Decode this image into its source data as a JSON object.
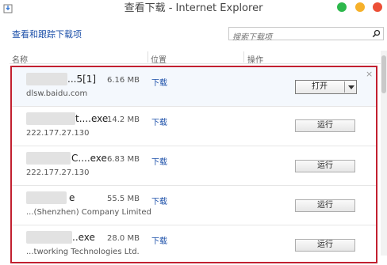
{
  "window": {
    "title": "查看下载 - Internet Explorer",
    "controls": {
      "minimize_color": "#2db84c",
      "maximize_color": "#f6b12a",
      "close_color": "#ec4f36"
    }
  },
  "header": {
    "link_label": "查看和跟踪下载项",
    "search_placeholder": "搜索下载项"
  },
  "columns": {
    "name": "名称",
    "location": "位置",
    "actions": "操作"
  },
  "downloads": [
    {
      "name": "...5[1]",
      "source": "dlsw.baidu.com",
      "size": "6.16 MB",
      "location": "下载",
      "action": "打开",
      "action_has_menu": true
    },
    {
      "name": "t....exe",
      "source": "222.177.27.130",
      "size": "14.2 MB",
      "location": "下载",
      "action": "运行"
    },
    {
      "name": "C....exe",
      "source": "222.177.27.130",
      "size": "6.83 MB",
      "location": "下载",
      "action": "运行"
    },
    {
      "name": "e",
      "source": "...(Shenzhen) Company Limited",
      "size": "55.5 MB",
      "location": "下载",
      "action": "运行"
    },
    {
      "name": "..exe",
      "source": "...tworking Technologies Ltd.",
      "size": "28.0 MB",
      "location": "下载",
      "action": "运行"
    }
  ],
  "close_glyph": "×",
  "accent_color": "#c22030"
}
